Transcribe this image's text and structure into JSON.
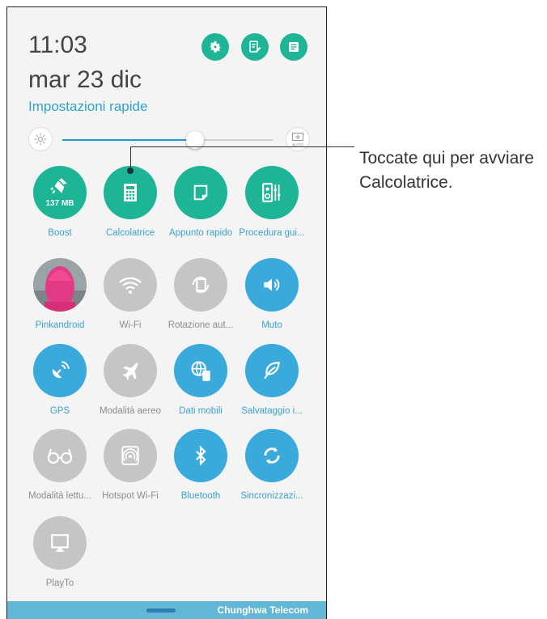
{
  "status": {
    "time": "11:03",
    "date": "mar 23 dic",
    "section_title": "Impostazioni rapide"
  },
  "header_buttons": [
    {
      "icon": "gear-icon"
    },
    {
      "icon": "edit-list-icon"
    },
    {
      "icon": "notes-icon"
    }
  ],
  "brightness": {
    "level_fraction": 0.63,
    "auto_label": "AUTO"
  },
  "tiles": [
    {
      "label": "Boost",
      "state": "green",
      "icon": "broom-icon",
      "badge": "137 MB"
    },
    {
      "label": "Calcolatrice",
      "state": "green",
      "icon": "calculator-icon"
    },
    {
      "label": "Appunto rapido",
      "state": "green",
      "icon": "note-icon"
    },
    {
      "label": "Procedura gui...",
      "state": "green",
      "icon": "speaker-eq-icon"
    },
    {
      "label": "Pinkandroid",
      "state": "photo",
      "icon": "avatar"
    },
    {
      "label": "Wi-Fi",
      "state": "gray",
      "icon": "wifi-icon"
    },
    {
      "label": "Rotazione aut...",
      "state": "gray",
      "icon": "rotation-icon"
    },
    {
      "label": "Muto",
      "state": "blue",
      "icon": "speaker-icon"
    },
    {
      "label": "GPS",
      "state": "blue",
      "icon": "gps-icon"
    },
    {
      "label": "Modalità aereo",
      "state": "gray",
      "icon": "airplane-icon"
    },
    {
      "label": "Dati mobili",
      "state": "blue",
      "icon": "mobile-data-icon"
    },
    {
      "label": "Salvataggio i...",
      "state": "blue",
      "icon": "leaf-icon"
    },
    {
      "label": "Modalità lettu...",
      "state": "gray",
      "icon": "glasses-icon"
    },
    {
      "label": "Hotspot Wi-Fi",
      "state": "gray",
      "icon": "hotspot-icon"
    },
    {
      "label": "Bluetooth",
      "state": "blue",
      "icon": "bluetooth-icon"
    },
    {
      "label": "Sincronizzazi...",
      "state": "blue",
      "icon": "sync-icon"
    },
    {
      "label": "PlayTo",
      "state": "gray",
      "icon": "playto-icon"
    }
  ],
  "bottom_bar": {
    "carrier": "Chunghwa Telecom"
  },
  "callout": {
    "line1": "Toccate qui per avviare",
    "line2": "Calcolatrice."
  },
  "colors": {
    "green": "#1eb496",
    "blue": "#3aa9dc",
    "gray": "#c5c5c5",
    "accent_text": "#2fa2c9"
  }
}
